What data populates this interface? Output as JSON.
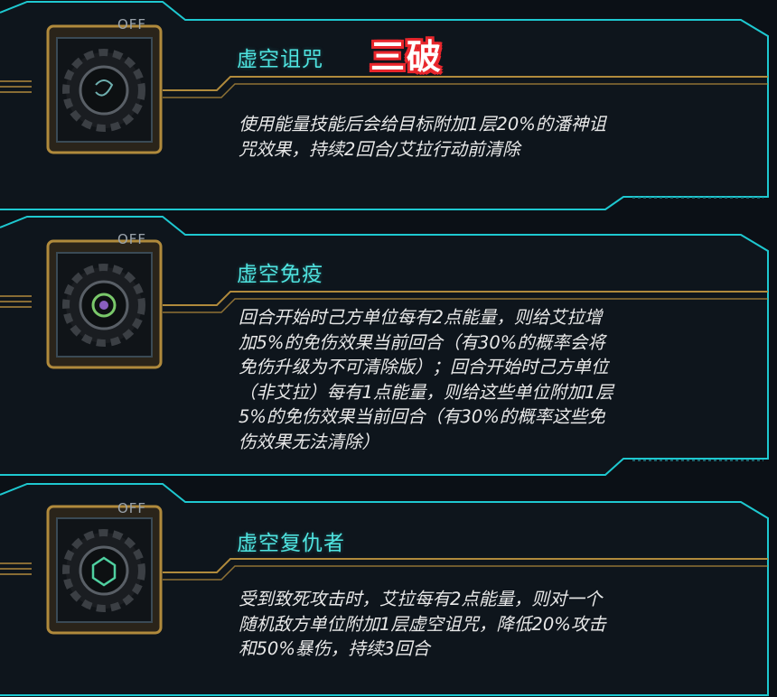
{
  "badge": {
    "label": "三破"
  },
  "cards": [
    {
      "toggle": "OFF",
      "title": "虚空诅咒",
      "desc_lines": [
        "使用能量技能后会给目标附加1层20%的潘神诅",
        "咒效果，持续2回合/艾拉行动前清除"
      ]
    },
    {
      "toggle": "OFF",
      "title": "虚空免疫",
      "desc_lines": [
        "回合开始时己方单位每有2点能量，则给艾拉增",
        "加5%的免伤效果当前回合（有30%的概率会将",
        "免伤升级为不可清除版）；回合开始时己方单位",
        "（非艾拉）每有1点能量，则给这些单位附加1层",
        "5%的免伤效果当前回合（有30%的概率这些免",
        "伤效果无法清除）"
      ]
    },
    {
      "toggle": "OFF",
      "title": "虚空复仇者",
      "desc_lines": [
        "受到致死攻击时，艾拉每有2点能量，则对一个",
        "随机敌方单位附加1层虚空诅咒，降低20%攻击",
        "和50%暴伤，持续3回合"
      ]
    }
  ],
  "colors": {
    "accent": "#4fe4e0",
    "frame": "#1ec8d0",
    "gold": "#b08a3c",
    "badge_red": "#e8262c"
  }
}
